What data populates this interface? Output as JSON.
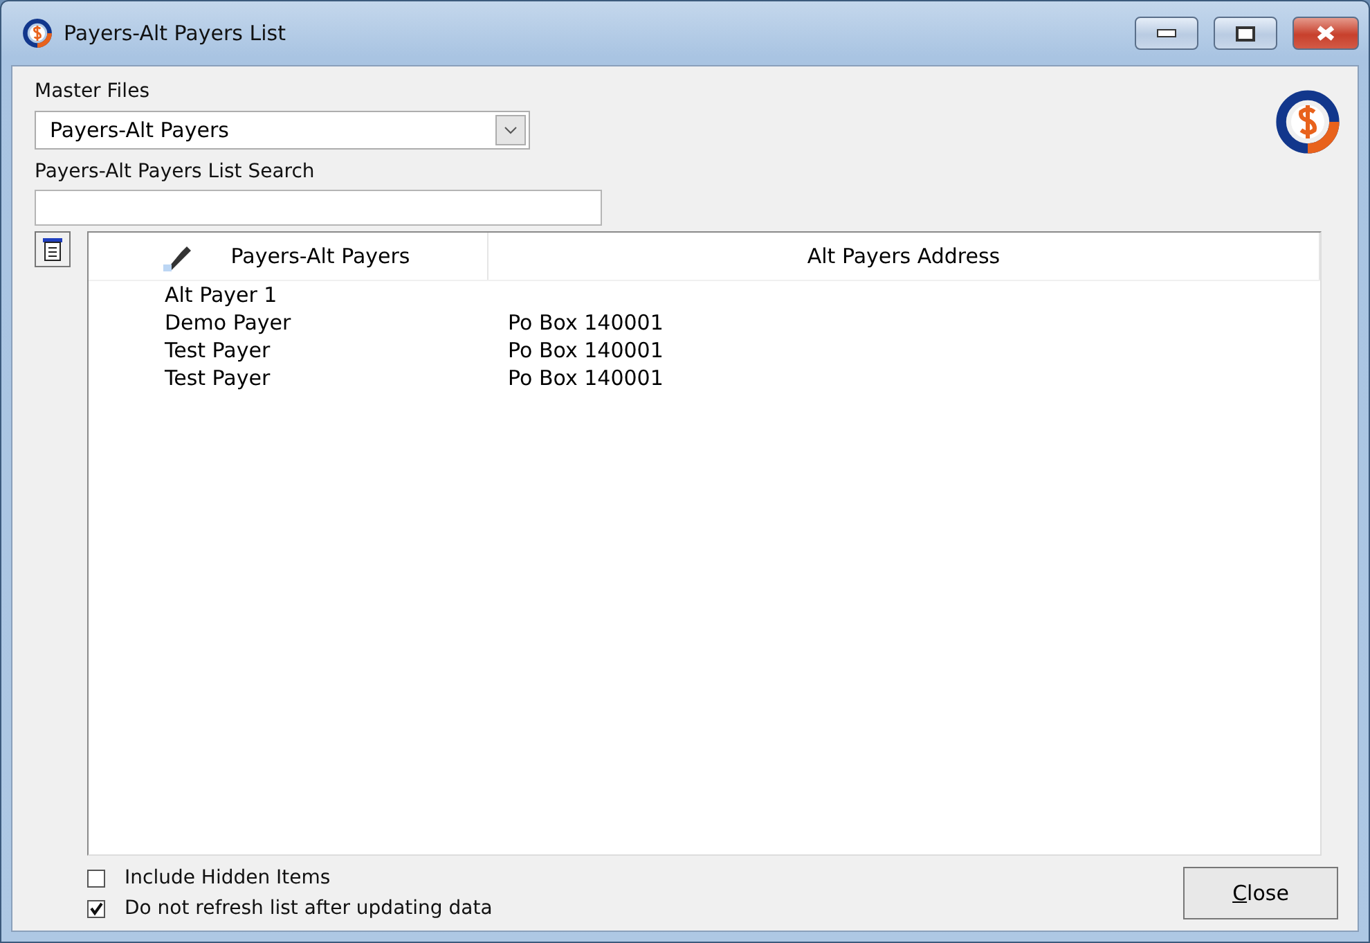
{
  "window": {
    "title": "Payers-Alt Payers List"
  },
  "master_files": {
    "label": "Master Files",
    "value": "Payers-Alt Payers"
  },
  "search": {
    "label": "Payers-Alt Payers List Search"
  },
  "table": {
    "columns": [
      "Payers-Alt Payers",
      "Alt Payers Address"
    ],
    "rows": [
      [
        "Alt Payer 1",
        ""
      ],
      [
        "Demo Payer",
        "Po Box 140001"
      ],
      [
        "Test Payer",
        "Po Box 140001"
      ],
      [
        "Test Payer",
        "Po Box 140001"
      ]
    ]
  },
  "options": [
    {
      "label": "Include Hidden Items",
      "checked": false
    },
    {
      "label": "Do not refresh list after updating data",
      "checked": true
    }
  ],
  "close_button": "Close"
}
